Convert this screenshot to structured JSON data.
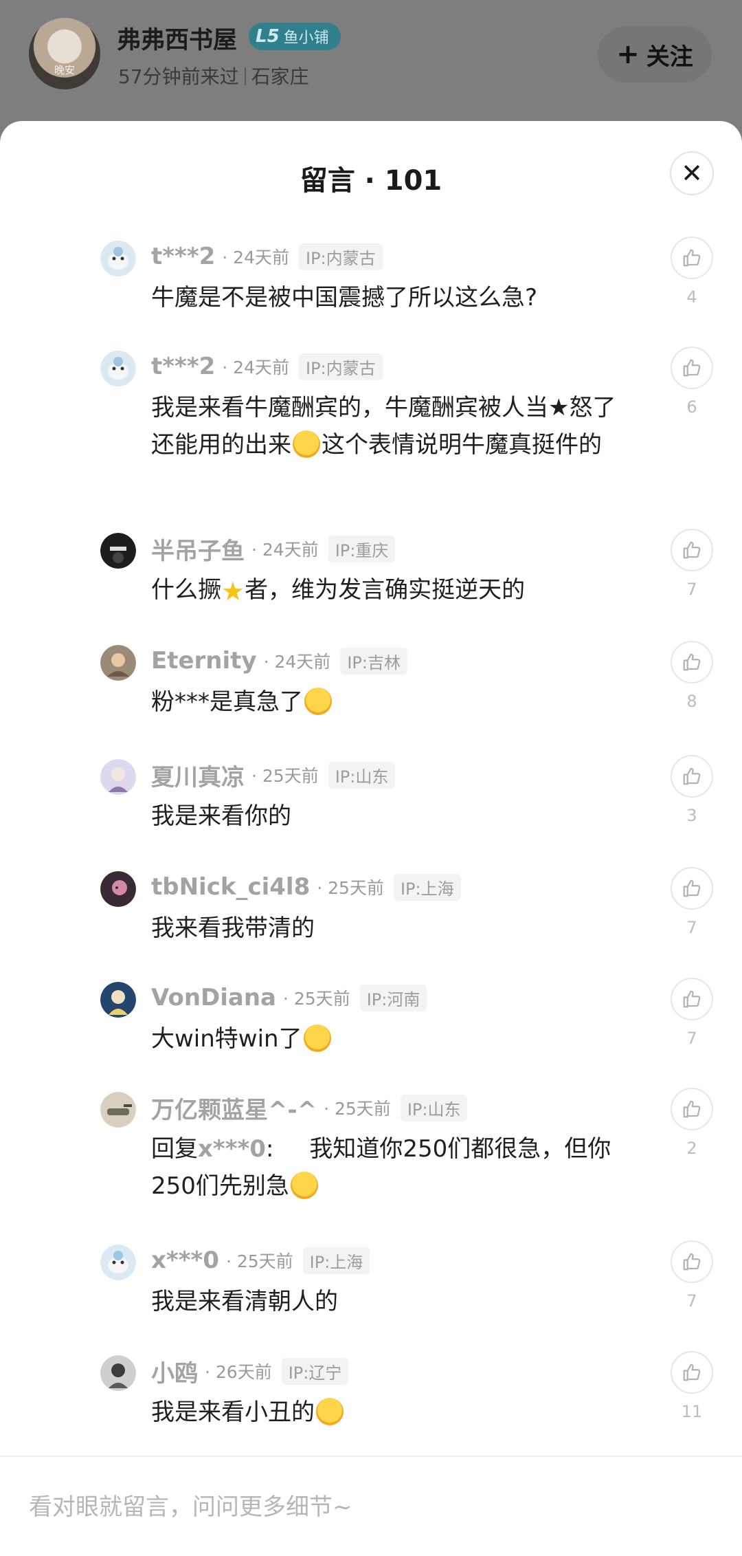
{
  "header": {
    "avatar_caption": "晚安",
    "shop_name": "弗弗西书屋",
    "level": "L5",
    "level_label": "鱼小铺",
    "visit_time": "57分钟前来过",
    "location": "石家庄",
    "follow_label": "关注",
    "follow_icon": "plus-icon"
  },
  "sheet": {
    "title": "留言 · 101",
    "close_icon": "close-icon"
  },
  "comments": [
    {
      "user": "t***2",
      "time": "· 24天前",
      "ip": "IP:内蒙古",
      "text": "牛魔是不是被中国震撼了所以这么急?",
      "likes": "4"
    },
    {
      "user": "t***2",
      "time": "· 24天前",
      "ip": "IP:内蒙古",
      "text_parts": [
        "我是来看牛魔酬宾的，牛魔酬宾被人当★怒了还能用的出来",
        "这个表情说明牛魔真挺件的"
      ],
      "likes": "6"
    },
    {
      "user": "半吊子鱼",
      "time": "· 24天前",
      "ip": "IP:重庆",
      "text_parts": [
        "什么撅",
        "者，维为发言确实挺逆天的"
      ],
      "likes": "7"
    },
    {
      "user": "Eternity",
      "time": "· 24天前",
      "ip": "IP:吉林",
      "text": "粉***是真急了",
      "likes": "8"
    },
    {
      "user": "夏川真凉",
      "time": "· 25天前",
      "ip": "IP:山东",
      "text": "我是来看你的",
      "likes": "3"
    },
    {
      "user": "tbNick_ci4l8",
      "time": "· 25天前",
      "ip": "IP:上海",
      "text": "我来看我带清的",
      "likes": "7"
    },
    {
      "user": "VonDiana",
      "time": "· 25天前",
      "ip": "IP:河南",
      "text": "大win特win了",
      "likes": "7"
    },
    {
      "user": "万亿颗蓝星^-^",
      "time": "· 25天前",
      "ip": "IP:山东",
      "reply_prefix": "回复",
      "reply_to": "x***0",
      "reply_colon": ":",
      "text": "我知道你250们都很急，但你250们先别急",
      "likes": "2"
    },
    {
      "user": "x***0",
      "time": "· 25天前",
      "ip": "IP:上海",
      "text": "我是来看清朝人的",
      "likes": "7"
    },
    {
      "user": "小鸥",
      "time": "· 26天前",
      "ip": "IP:辽宁",
      "text": "我是来看小丑的",
      "likes": "11"
    }
  ],
  "input": {
    "placeholder": "看对眼就留言，问问更多细节~"
  }
}
